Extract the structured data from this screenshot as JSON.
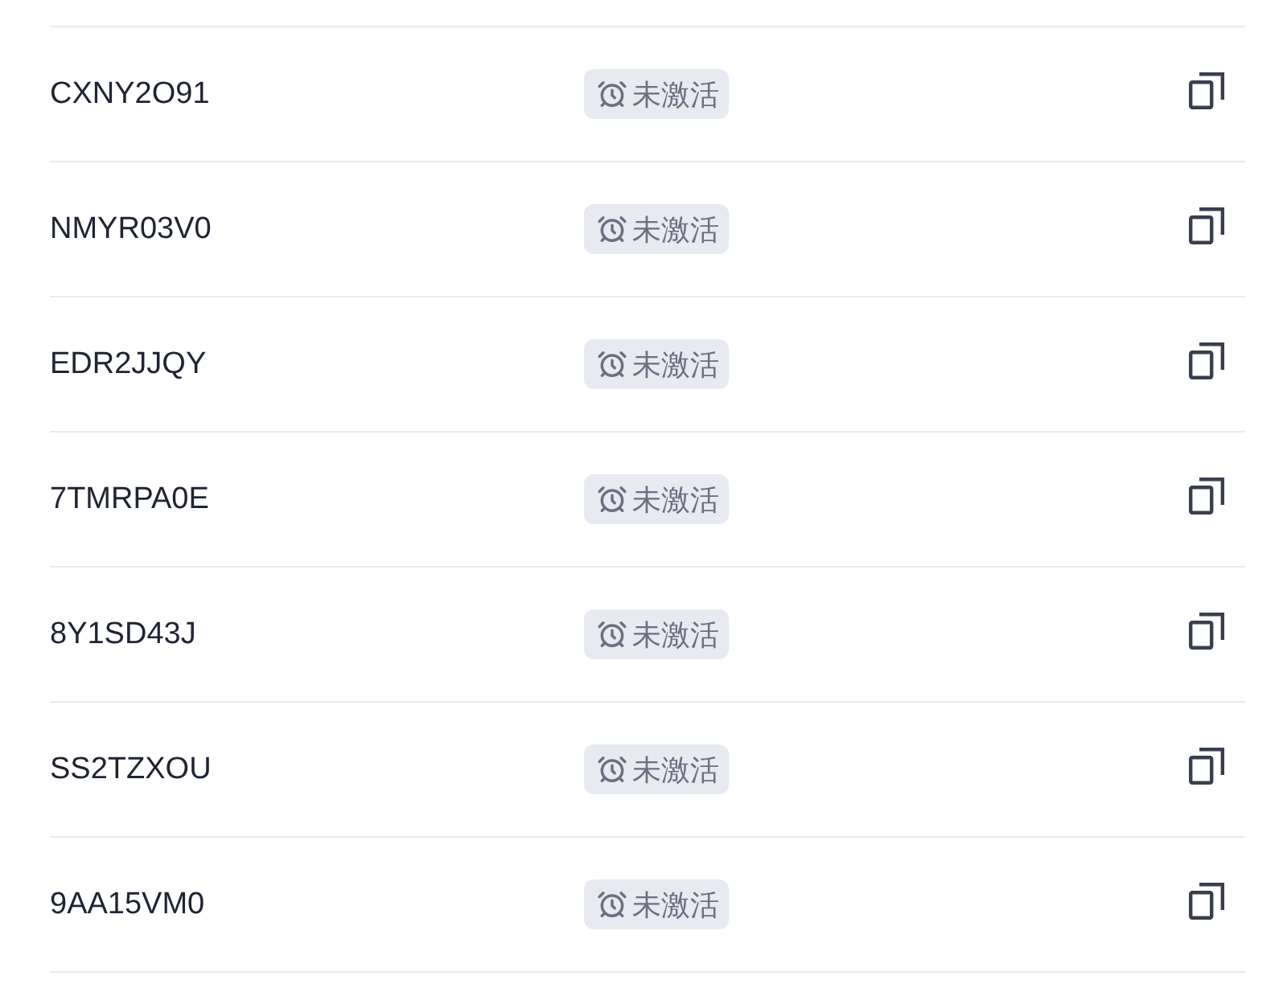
{
  "codes": [
    {
      "code": "CXNY2O91",
      "status": "未激活"
    },
    {
      "code": "NMYR03V0",
      "status": "未激活"
    },
    {
      "code": "EDR2JJQY",
      "status": "未激活"
    },
    {
      "code": "7TMRPA0E",
      "status": "未激活"
    },
    {
      "code": "8Y1SD43J",
      "status": "未激活"
    },
    {
      "code": "SS2TZXOU",
      "status": "未激活"
    },
    {
      "code": "9AA15VM0",
      "status": "未激活"
    }
  ]
}
